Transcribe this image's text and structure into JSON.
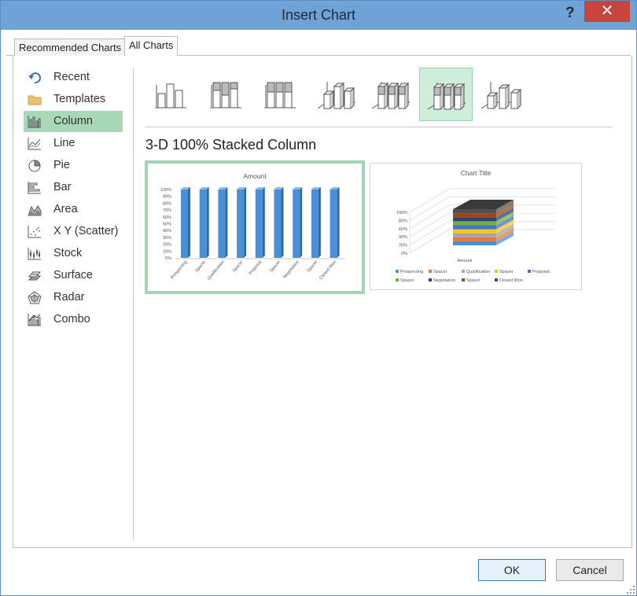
{
  "window": {
    "title": "Insert Chart",
    "help": "?",
    "close": "✕"
  },
  "tabs": [
    {
      "label": "Recommended Charts"
    },
    {
      "label": "All Charts"
    }
  ],
  "categories": [
    {
      "label": "Recent",
      "icon": "undo-icon"
    },
    {
      "label": "Templates",
      "icon": "folder-icon"
    },
    {
      "label": "Column",
      "icon": "column-chart-icon"
    },
    {
      "label": "Line",
      "icon": "line-chart-icon"
    },
    {
      "label": "Pie",
      "icon": "pie-chart-icon"
    },
    {
      "label": "Bar",
      "icon": "bar-chart-icon"
    },
    {
      "label": "Area",
      "icon": "area-chart-icon"
    },
    {
      "label": "X Y (Scatter)",
      "icon": "scatter-chart-icon"
    },
    {
      "label": "Stock",
      "icon": "stock-chart-icon"
    },
    {
      "label": "Surface",
      "icon": "surface-chart-icon"
    },
    {
      "label": "Radar",
      "icon": "radar-chart-icon"
    },
    {
      "label": "Combo",
      "icon": "combo-chart-icon"
    }
  ],
  "selected_category": "Column",
  "subtype_count": 7,
  "selected_subtype_index": 5,
  "selected_type_name": "3-D 100% Stacked Column",
  "chart_data": [
    {
      "type": "bar",
      "title": "Amount",
      "categories": [
        "Prospecting",
        "Spacer",
        "Qualification",
        "Spacer",
        "Proposal",
        "Spacer",
        "Negotiation",
        "Spacer",
        "Closed Won"
      ],
      "values": [
        100,
        100,
        100,
        100,
        100,
        100,
        100,
        100,
        100
      ],
      "yticks": [
        "100%",
        "90%",
        "80%",
        "70%",
        "60%",
        "50%",
        "40%",
        "30%",
        "20%",
        "10%",
        "0%"
      ],
      "ylim": [
        0,
        100
      ],
      "color": "#4a90d6"
    },
    {
      "type": "bar",
      "title": "Chart Title",
      "categories": [
        "Amount"
      ],
      "series": [
        {
          "name": "Prospecting",
          "color": "#4a90d6"
        },
        {
          "name": "Spacer",
          "color": "#e8773a"
        },
        {
          "name": "Qualification",
          "color": "#a5a5a5"
        },
        {
          "name": "Spacer",
          "color": "#f5c518"
        },
        {
          "name": "Proposal",
          "color": "#4472c4"
        },
        {
          "name": "Spacer",
          "color": "#70ad47"
        },
        {
          "name": "Negotiation",
          "color": "#264478"
        },
        {
          "name": "Spacer",
          "color": "#9e480e"
        },
        {
          "name": "Closed Won",
          "color": "#505050"
        }
      ],
      "yticks": [
        "100%",
        "80%",
        "60%",
        "40%",
        "20%",
        "0%"
      ],
      "ylim": [
        0,
        100
      ]
    }
  ],
  "buttons": {
    "ok": "OK",
    "cancel": "Cancel"
  }
}
